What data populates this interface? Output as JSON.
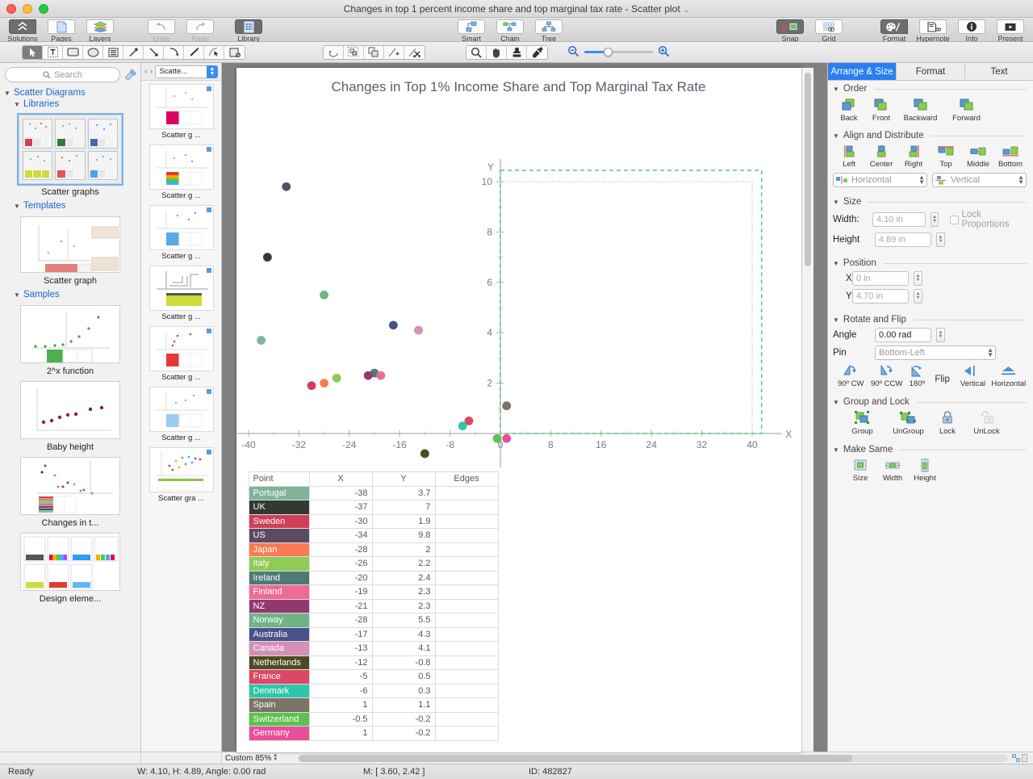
{
  "window": {
    "title": "Changes in top 1 percent income share and top marginal tax rate - Scatter plot",
    "title_chevron": "⌄"
  },
  "toolbar": {
    "left": [
      {
        "label": "Solutions",
        "icon": "solutions-icon",
        "active": true
      },
      {
        "label": "Pages",
        "icon": "pages-icon",
        "active": false
      },
      {
        "label": "Layers",
        "icon": "layers-icon",
        "active": false
      }
    ],
    "history": [
      {
        "label": "Undo",
        "icon": "undo-arrow-icon",
        "disabled": true
      },
      {
        "label": "Redo",
        "icon": "redo-arrow-icon",
        "disabled": true
      }
    ],
    "library": {
      "label": "Library",
      "icon": "library-icon",
      "active": true
    },
    "middle": [
      {
        "label": "Smart",
        "icon": "smart-connector-icon"
      },
      {
        "label": "Chain",
        "icon": "chain-connector-icon"
      },
      {
        "label": "Tree",
        "icon": "tree-connector-icon"
      }
    ],
    "snapgrid": [
      {
        "label": "Snap",
        "icon": "snap-icon",
        "active": true
      },
      {
        "label": "Grid",
        "icon": "grid-icon",
        "active": false
      }
    ],
    "right": [
      {
        "label": "Format",
        "icon": "format-palette-icon",
        "active": true
      },
      {
        "label": "Hypernote",
        "icon": "hypernote-icon",
        "active": false
      },
      {
        "label": "Info",
        "icon": "info-icon",
        "active": false
      },
      {
        "label": "Present",
        "icon": "present-icon",
        "active": false
      }
    ]
  },
  "tools": {
    "group1": [
      "pointer-icon",
      "text-icon",
      "rectangle-icon",
      "ellipse-icon",
      "table-icon",
      "arrow-icon",
      "line-icon",
      "curve-icon",
      "pen-icon",
      "bezier-icon",
      "stamp-shape-icon"
    ],
    "group2": [
      "rotate-icon",
      "smart-select-icon",
      "duplicate-icon",
      "add-point-icon",
      "cut-icon"
    ],
    "group3": [
      "magnifier-icon",
      "hand-icon",
      "stamp-icon",
      "eyedropper-icon"
    ],
    "zoom_out_icon": "zoom-out-icon",
    "zoom_in_icon": "zoom-in-icon"
  },
  "sidebar": {
    "search": {
      "placeholder": "Search",
      "icon": "search-icon"
    },
    "gavel_icon": "gavel-icon",
    "tree": [
      {
        "label": "Scatter Diagrams",
        "level": 1
      },
      {
        "label": "Libraries",
        "level": 2
      }
    ],
    "library_item": {
      "caption": "Scatter graphs",
      "selected": true
    },
    "sections": [
      {
        "label": "Templates",
        "level": 2
      },
      {
        "label": "Samples",
        "level": 2
      }
    ],
    "templates": [
      {
        "caption": "Scatter graph"
      }
    ],
    "samples": [
      {
        "caption": "2^x function"
      },
      {
        "caption": "Baby height"
      },
      {
        "caption": "Changes in t..."
      },
      {
        "caption": "Design eleme..."
      }
    ]
  },
  "pages": {
    "prev_icon": "chevron-left-icon",
    "next_icon": "chevron-right-icon",
    "selector_value": "Scatte...",
    "items": [
      {
        "caption": "Scatter g ..."
      },
      {
        "caption": "Scatter g ..."
      },
      {
        "caption": "Scatter g ..."
      },
      {
        "caption": "Scatter g ..."
      },
      {
        "caption": "Scatter g ..."
      },
      {
        "caption": "Scatter g ..."
      },
      {
        "caption": "Scatter gra ..."
      }
    ]
  },
  "chart_data": {
    "type": "scatter",
    "title": "Changes in Top 1% Income Share and Top Marginal Tax Rate",
    "xlabel": "X",
    "ylabel": "Y",
    "xlim": [
      -44,
      44
    ],
    "ylim": [
      -1.6,
      10.9
    ],
    "xticks": [
      -40,
      -32,
      -24,
      -16,
      -8,
      0,
      8,
      16,
      24,
      32,
      40
    ],
    "yticks": [
      2,
      4,
      6,
      8,
      10
    ],
    "xminor": [
      -36,
      -28,
      -20,
      -12,
      -4,
      4,
      12,
      20,
      28,
      36
    ],
    "yminor": [
      1,
      3,
      5,
      7,
      9
    ],
    "grid": false,
    "legend": "none",
    "points": [
      {
        "name": "Portugal",
        "x": -38,
        "y": 3.7,
        "color": "#7fb49a"
      },
      {
        "name": "UK",
        "x": -37,
        "y": 7,
        "color": "#2f3a33"
      },
      {
        "name": "Sweden",
        "x": -30,
        "y": 1.9,
        "color": "#cf4058"
      },
      {
        "name": "US",
        "x": -34,
        "y": 9.8,
        "color": "#5c4a63"
      },
      {
        "name": "Japan",
        "x": -28,
        "y": 2,
        "color": "#fb7a54"
      },
      {
        "name": "Italy",
        "x": -26,
        "y": 2.2,
        "color": "#8fcc55"
      },
      {
        "name": "Ireland",
        "x": -20,
        "y": 2.4,
        "color": "#4d7a73"
      },
      {
        "name": "Finland",
        "x": -19,
        "y": 2.3,
        "color": "#ee6b96"
      },
      {
        "name": "NZ",
        "x": -21,
        "y": 2.3,
        "color": "#93386e"
      },
      {
        "name": "Norway",
        "x": -28,
        "y": 5.5,
        "color": "#6fb487"
      },
      {
        "name": "Australia",
        "x": -17,
        "y": 4.3,
        "color": "#47528b"
      },
      {
        "name": "Canada",
        "x": -13,
        "y": 4.1,
        "color": "#d490b5"
      },
      {
        "name": "Netherlands",
        "x": -12,
        "y": -0.8,
        "color": "#4e4b20"
      },
      {
        "name": "France",
        "x": -5,
        "y": 0.5,
        "color": "#dd4766"
      },
      {
        "name": "Denmark",
        "x": -6,
        "y": 0.3,
        "color": "#2dc6a8"
      },
      {
        "name": "Spain",
        "x": 1,
        "y": 1.1,
        "color": "#7c7266"
      },
      {
        "name": "Switzerland",
        "x": -0.5,
        "y": -0.2,
        "color": "#5cc14f"
      },
      {
        "name": "Germany",
        "x": 1,
        "y": -0.2,
        "color": "#e84f9a"
      }
    ]
  },
  "table": {
    "headers": [
      "Point",
      "X",
      "Y",
      "Edges"
    ],
    "rows": [
      {
        "point": "Portugal",
        "x": "-38",
        "y": "3.7",
        "edges": "",
        "color": "#7fb49a"
      },
      {
        "point": "UK",
        "x": "-37",
        "y": "7",
        "edges": "",
        "color": "#2f3a33"
      },
      {
        "point": "Sweden",
        "x": "-30",
        "y": "1.9",
        "edges": "",
        "color": "#cf4058"
      },
      {
        "point": "US",
        "x": "-34",
        "y": "9.8",
        "edges": "",
        "color": "#5c4a63"
      },
      {
        "point": "Japan",
        "x": "-28",
        "y": "2",
        "edges": "",
        "color": "#fb7a54"
      },
      {
        "point": "Italy",
        "x": "-26",
        "y": "2.2",
        "edges": "",
        "color": "#8fcc55"
      },
      {
        "point": "Ireland",
        "x": "-20",
        "y": "2.4",
        "edges": "",
        "color": "#4d7a73"
      },
      {
        "point": "Finland",
        "x": "-19",
        "y": "2.3",
        "edges": "",
        "color": "#ee6b96"
      },
      {
        "point": "NZ",
        "x": "-21",
        "y": "2.3",
        "edges": "",
        "color": "#93386e"
      },
      {
        "point": "Norway",
        "x": "-28",
        "y": "5.5",
        "edges": "",
        "color": "#6fb487"
      },
      {
        "point": "Australia",
        "x": "-17",
        "y": "4.3",
        "edges": "",
        "color": "#47528b"
      },
      {
        "point": "Canada",
        "x": "-13",
        "y": "4.1",
        "edges": "",
        "color": "#d490b5"
      },
      {
        "point": "Netherlands",
        "x": "-12",
        "y": "-0.8",
        "edges": "",
        "color": "#4e4b20"
      },
      {
        "point": "France",
        "x": "-5",
        "y": "0.5",
        "edges": "",
        "color": "#dd4766"
      },
      {
        "point": "Denmark",
        "x": "-6",
        "y": "0.3",
        "edges": "",
        "color": "#2dc6a8"
      },
      {
        "point": "Spain",
        "x": "1",
        "y": "1.1",
        "edges": "",
        "color": "#7c7266"
      },
      {
        "point": "Switzerland",
        "x": "-0.5",
        "y": "-0.2",
        "edges": "",
        "color": "#5cc14f"
      },
      {
        "point": "Germany",
        "x": "1",
        "y": "-0.2",
        "edges": "",
        "color": "#e84f9a"
      }
    ]
  },
  "inspector": {
    "tabs": [
      {
        "label": "Arrange & Size",
        "active": true
      },
      {
        "label": "Format",
        "active": false
      },
      {
        "label": "Text",
        "active": false
      }
    ],
    "order": {
      "title": "Order",
      "buttons": [
        {
          "label": "Back",
          "icon": "send-to-back-icon"
        },
        {
          "label": "Front",
          "icon": "bring-to-front-icon"
        },
        {
          "label": "Backward",
          "icon": "send-backward-icon"
        },
        {
          "label": "Forward",
          "icon": "bring-forward-icon"
        }
      ]
    },
    "align": {
      "title": "Align and Distribute",
      "buttons": [
        {
          "label": "Left",
          "icon": "align-left-icon"
        },
        {
          "label": "Center",
          "icon": "align-center-icon"
        },
        {
          "label": "Right",
          "icon": "align-right-icon"
        },
        {
          "label": "Top",
          "icon": "align-top-icon"
        },
        {
          "label": "Middle",
          "icon": "align-middle-icon"
        },
        {
          "label": "Bottom",
          "icon": "align-bottom-icon"
        }
      ],
      "horizontal": "Horizontal",
      "vertical": "Vertical"
    },
    "size": {
      "title": "Size",
      "width_label": "Width:",
      "width_value": "4.10 in",
      "height_label": "Height",
      "height_value": "4.89 in",
      "lock_label": "Lock Proportions"
    },
    "position": {
      "title": "Position",
      "x_label": "X",
      "x_value": "0 in",
      "y_label": "Y",
      "y_value": "4.70 in"
    },
    "rotate": {
      "title": "Rotate and Flip",
      "angle_label": "Angle",
      "angle_value": "0.00 rad",
      "pin_label": "Pin",
      "pin_value": "Bottom-Left",
      "flip_label": "Flip",
      "buttons": [
        {
          "label": "90º CW",
          "icon": "rotate-cw-icon"
        },
        {
          "label": "90º CCW",
          "icon": "rotate-ccw-icon"
        },
        {
          "label": "180º",
          "icon": "rotate-180-icon"
        },
        {
          "label": "Vertical",
          "icon": "flip-vertical-icon"
        },
        {
          "label": "Horizontal",
          "icon": "flip-horizontal-icon"
        }
      ]
    },
    "group": {
      "title": "Group and Lock",
      "buttons": [
        {
          "label": "Group",
          "icon": "group-icon"
        },
        {
          "label": "UnGroup",
          "icon": "ungroup-icon"
        },
        {
          "label": "Lock",
          "icon": "lock-icon"
        },
        {
          "label": "UnLock",
          "icon": "unlock-icon"
        }
      ]
    },
    "makesame": {
      "title": "Make Same",
      "buttons": [
        {
          "label": "Size",
          "icon": "same-size-icon"
        },
        {
          "label": "Width",
          "icon": "same-width-icon"
        },
        {
          "label": "Height",
          "icon": "same-height-icon"
        }
      ]
    }
  },
  "statusbar": {
    "ready": "Ready",
    "dims": "W: 4.10,  H: 4.89,  Angle: 0.00 rad",
    "mouse": "M: [ 3.60, 2.42 ]",
    "id": "ID: 482827",
    "zoom": "Custom 85%"
  }
}
